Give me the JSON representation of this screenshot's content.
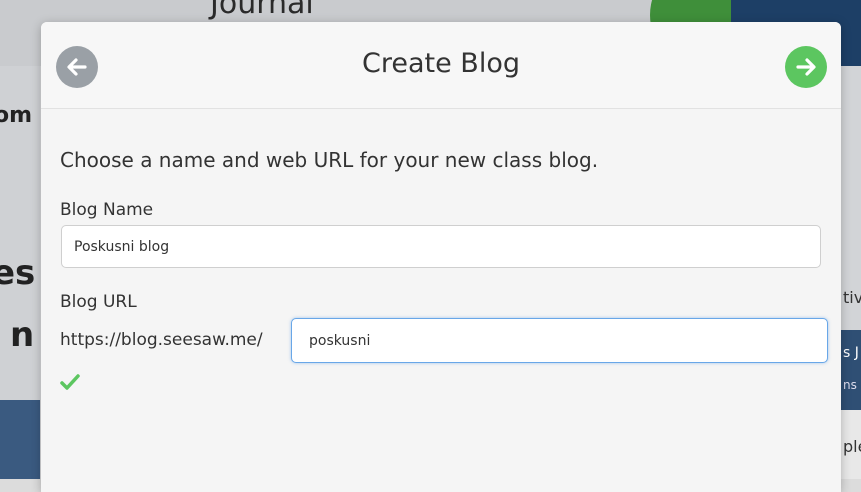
{
  "background": {
    "journal_text": "Journal",
    "left_fragments": [
      "om",
      "es",
      "n"
    ],
    "right_fragments": [
      "tiv",
      "s J",
      "ns",
      "ple"
    ]
  },
  "modal": {
    "title": "Create Blog",
    "back_icon": "arrow-left-icon",
    "next_icon": "arrow-right-icon",
    "intro": "Choose a name and web URL for your new class blog.",
    "blog_name": {
      "label": "Blog Name",
      "value": "Poskusni blog"
    },
    "blog_url": {
      "label": "Blog URL",
      "prefix": "https://blog.seesaw.me/",
      "value": "poskusni"
    },
    "validation_icon": "checkmark-icon"
  },
  "colors": {
    "accent_green": "#5cc660",
    "back_gray": "#9aa0a6",
    "focus_blue": "#69a7e8"
  }
}
